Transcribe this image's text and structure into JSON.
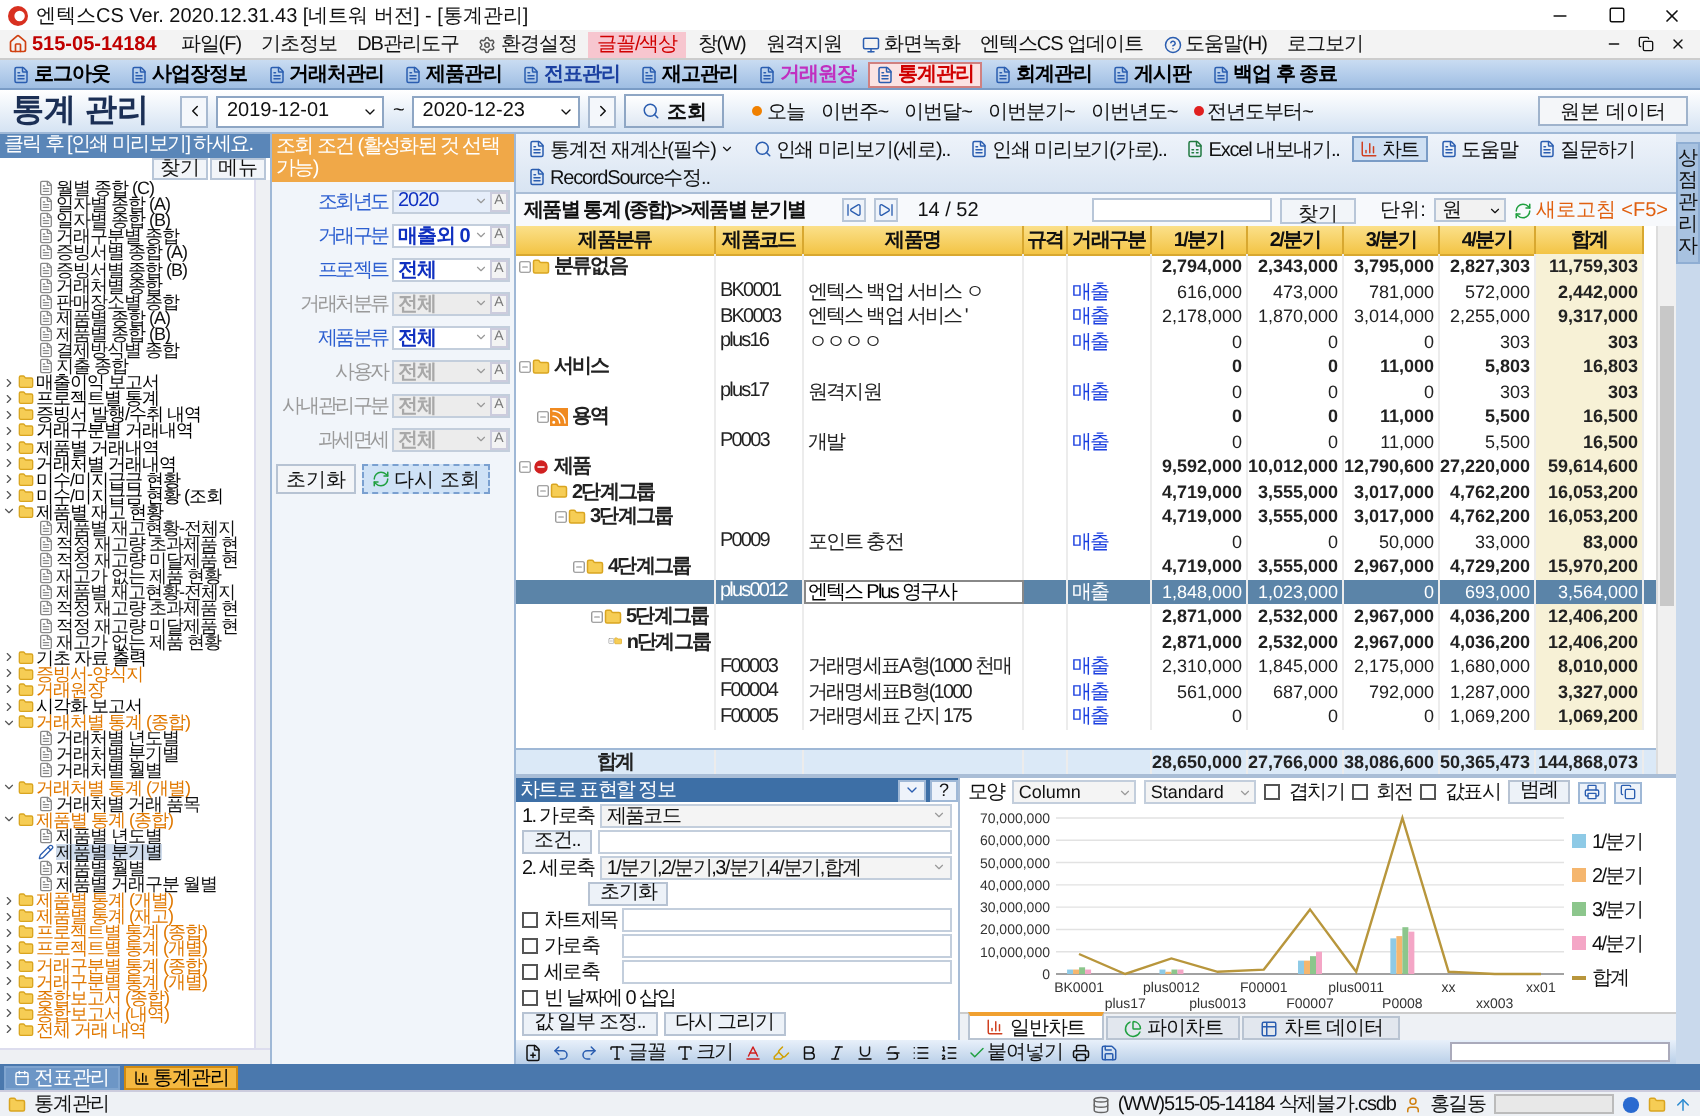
{
  "window": {
    "title": "엔텍스CS Ver. 2020.12.31.43 [네트워 버전] - [통계관리]"
  },
  "menu_bar": {
    "business_number": "515-05-14184",
    "items": [
      {
        "label": "파일(F)",
        "kind": "plain",
        "highlighted": false
      },
      {
        "label": "기초정보",
        "kind": "plain",
        "highlighted": false
      },
      {
        "label": "DB관리도구",
        "kind": "plain",
        "highlighted": false
      },
      {
        "label": "환경설정",
        "kind": "gear",
        "highlighted": false
      },
      {
        "label": "글꼴/색상",
        "kind": "plain",
        "highlighted": true
      },
      {
        "label": "창(W)",
        "kind": "plain",
        "highlighted": false
      },
      {
        "label": "원격지원",
        "kind": "plain",
        "highlighted": false
      },
      {
        "label": "화면녹화",
        "kind": "screen",
        "highlighted": false
      },
      {
        "label": "엔텍스CS 업데이트",
        "kind": "plain",
        "highlighted": false
      },
      {
        "label": "도움말(H)",
        "kind": "help",
        "highlighted": false
      },
      {
        "label": "로그보기",
        "kind": "plain",
        "highlighted": false
      }
    ]
  },
  "toolbar": [
    {
      "label": "로그아웃",
      "color": "#000000",
      "selected": false
    },
    {
      "label": "사업장정보",
      "color": "#000000",
      "selected": false
    },
    {
      "label": "거래처관리",
      "color": "#000000",
      "selected": false
    },
    {
      "label": "제품관리",
      "color": "#000000",
      "selected": false
    },
    {
      "label": "전표관리",
      "color": "#1a3fa0",
      "selected": false
    },
    {
      "label": "재고관리",
      "color": "#000000",
      "selected": false
    },
    {
      "label": "거래원장",
      "color": "#c030c0",
      "selected": false
    },
    {
      "label": "통계관리",
      "color": "#d00000",
      "selected": true
    },
    {
      "label": "회계관리",
      "color": "#000000",
      "selected": false
    },
    {
      "label": "게시판",
      "color": "#000000",
      "selected": false
    },
    {
      "label": "백업 후 종료",
      "color": "#000000",
      "selected": false
    }
  ],
  "header": {
    "title": "통계 관리",
    "date_from": "2019-12-01",
    "range_separator": "~",
    "date_to": "2020-12-23",
    "search_button": "조회",
    "quick_ranges": [
      {
        "label": "오늘",
        "color": "#f08000"
      },
      {
        "label": "이번주~"
      },
      {
        "label": "이번달~"
      },
      {
        "label": "이번분기~"
      },
      {
        "label": "이번년도~"
      },
      {
        "label": "전년도부터~",
        "color": "#e02020"
      }
    ],
    "source_button": "원본 데이터"
  },
  "side_tabs": [
    "상점관리자"
  ],
  "left_panel": {
    "hint": "클릭 후 [인쇄 미리보기] 하세요.",
    "buttons": [
      "찾기",
      "메뉴"
    ],
    "tree": [
      {
        "kind": "group",
        "children": [
          {
            "kind": "report",
            "label": "월별 종합 (C)",
            "selected": false
          },
          {
            "kind": "report",
            "label": "일자별 종합 (A)",
            "selected": false
          },
          {
            "kind": "report",
            "label": "일자별 종합 (B)",
            "selected": false
          },
          {
            "kind": "report",
            "label": "거래구분별 종합",
            "selected": false
          },
          {
            "kind": "report",
            "label": "증빙서별 종합 (A)",
            "selected": false
          },
          {
            "kind": "report",
            "label": "증빙서별 종합 (B)",
            "selected": false
          },
          {
            "kind": "report",
            "label": "거래처별 종합",
            "selected": false
          },
          {
            "kind": "report",
            "label": "판매장소별 종합",
            "selected": false
          },
          {
            "kind": "report",
            "label": "제품별 종합 (A)",
            "selected": false
          },
          {
            "kind": "report",
            "label": "제품별 종합 (B)",
            "selected": false
          },
          {
            "kind": "report",
            "label": "결제방식별 종합",
            "selected": false
          },
          {
            "kind": "report",
            "label": "지출 종합",
            "selected": false
          }
        ]
      },
      {
        "kind": "folder",
        "label": "매출이익 보고서",
        "color": "#000000",
        "expanded": false
      },
      {
        "kind": "folder",
        "label": "프로젝트별 통계",
        "color": "#000000",
        "expanded": false
      },
      {
        "kind": "folder",
        "label": "증빙서 발행/수취 내역",
        "color": "#000000",
        "expanded": false
      },
      {
        "kind": "folder",
        "label": "거래구분별 거래내역",
        "color": "#000000",
        "expanded": false
      },
      {
        "kind": "folder",
        "label": "제품별 거래내역",
        "color": "#000000",
        "expanded": false
      },
      {
        "kind": "folder",
        "label": "거래처별 거래내역",
        "color": "#000000",
        "expanded": false
      },
      {
        "kind": "folder",
        "label": "미수/미지급금 현황",
        "color": "#000000",
        "expanded": false
      },
      {
        "kind": "folder",
        "label": "미수/미지급금 현황 (조회",
        "color": "#000000",
        "expanded": false
      },
      {
        "kind": "folder",
        "label": "제품별 재고 현황",
        "color": "#000000",
        "expanded": true,
        "children": [
          {
            "kind": "report",
            "label": "제품별 재고현황-전체지",
            "selected": false
          },
          {
            "kind": "report",
            "label": "적정 재고량 초과제품 현",
            "selected": false
          },
          {
            "kind": "report",
            "label": "적정 재고량 미달제품 현",
            "selected": false
          },
          {
            "kind": "report",
            "label": "재고가 없는 제품 현황",
            "selected": false
          },
          {
            "kind": "report",
            "label": "제품별 재고현황-전체지",
            "selected": false
          },
          {
            "kind": "report",
            "label": "적정 재고량 초과제품 현",
            "selected": false
          },
          {
            "kind": "report",
            "label": "적정 재고량 미달제품 현",
            "selected": false
          },
          {
            "kind": "report",
            "label": "재고가 없는 제품 현황",
            "selected": false
          }
        ]
      },
      {
        "kind": "folder",
        "label": "기초 자료 출력",
        "color": "#000000",
        "expanded": false
      },
      {
        "kind": "folder",
        "label": "증빙서-양식지",
        "color": "#e07800",
        "expanded": false
      },
      {
        "kind": "folder",
        "label": "거래원장",
        "color": "#e07800",
        "expanded": false
      },
      {
        "kind": "folder",
        "label": "시각화 보고서",
        "color": "#000000",
        "expanded": false
      },
      {
        "kind": "folder",
        "label": "거래처별 통계 (종합)",
        "color": "#e07800",
        "expanded": true,
        "children": [
          {
            "kind": "report",
            "label": "거래처별 년도별",
            "selected": false
          },
          {
            "kind": "report",
            "label": "거래처별 분기별",
            "selected": false
          },
          {
            "kind": "report",
            "label": "거래처별 월별",
            "selected": false
          }
        ]
      },
      {
        "kind": "folder",
        "label": "거래처별 통계 (개별)",
        "color": "#e07800",
        "expanded": true,
        "children": [
          {
            "kind": "report",
            "label": "거래처별 거래 품목",
            "selected": false
          }
        ]
      },
      {
        "kind": "folder",
        "label": "제품별 통계 (종합)",
        "color": "#e07800",
        "expanded": true,
        "children": [
          {
            "kind": "report",
            "label": "제품별 년도별",
            "selected": false
          },
          {
            "kind": "report",
            "label": "제품별 분기별",
            "selected": true
          },
          {
            "kind": "report",
            "label": "제품별 월별",
            "selected": false
          },
          {
            "kind": "report",
            "label": "제품별 거래구분 월별",
            "selected": false
          }
        ]
      },
      {
        "kind": "folder",
        "label": "제품별 통계 (개별)",
        "color": "#e07800",
        "expanded": false
      },
      {
        "kind": "folder",
        "label": "제품별 통계 (재고)",
        "color": "#e07800",
        "expanded": false
      },
      {
        "kind": "folder",
        "label": "프로젝트별 통계 (종합)",
        "color": "#e07800",
        "expanded": false
      },
      {
        "kind": "folder",
        "label": "프로젝트별 통계 (개별)",
        "color": "#e07800",
        "expanded": false
      },
      {
        "kind": "folder",
        "label": "거래구분별 통계 (종합)",
        "color": "#e07800",
        "expanded": false
      },
      {
        "kind": "folder",
        "label": "거래구분별 통계 (개별)",
        "color": "#e07800",
        "expanded": false
      },
      {
        "kind": "folder",
        "label": "종합보고서 (종합)",
        "color": "#e07800",
        "expanded": false
      },
      {
        "kind": "folder",
        "label": "종합보고서 (내역)",
        "color": "#e07800",
        "expanded": false
      },
      {
        "kind": "folder",
        "label": "전체 거래 내역",
        "color": "#e07800",
        "expanded": false
      }
    ]
  },
  "conditions": {
    "title": "조회 조건 (활성화된 것 선택 가능)",
    "fields": [
      {
        "label": "조회년도",
        "value": "2020",
        "kind": "year",
        "enabled": true,
        "button": "A"
      },
      {
        "label": "거래구분",
        "value": "매출외 0",
        "kind": "select",
        "enabled": true,
        "button": "A"
      },
      {
        "label": "프로젝트",
        "value": "전체",
        "kind": "select",
        "enabled": true,
        "button": "A"
      },
      {
        "label": "거래처분류",
        "value": "전체",
        "kind": "select",
        "enabled": false,
        "button": "A"
      },
      {
        "label": "제품분류",
        "value": "전체",
        "kind": "select",
        "enabled": true,
        "button": "A"
      },
      {
        "label": "사용자",
        "value": "전체",
        "kind": "select",
        "enabled": false,
        "button": "A"
      },
      {
        "label": "사내관리구분",
        "value": "전체",
        "kind": "select",
        "enabled": false,
        "button": "A"
      },
      {
        "label": "과세면세",
        "value": "전체",
        "kind": "select",
        "enabled": false,
        "button": "A"
      }
    ],
    "reset_button": "초기화",
    "requery_button": "다시 조회"
  },
  "actions": [
    {
      "label": "통계전 재계산(필수)",
      "kind": "menu",
      "selected": false
    },
    {
      "label": "인쇄 미리보기(세로)..",
      "kind": "preview",
      "selected": false
    },
    {
      "label": "인쇄 미리보기(가로)..",
      "kind": "doc",
      "selected": false
    },
    {
      "label": "Excel 내보내기..",
      "kind": "export",
      "selected": false
    },
    {
      "label": "차트",
      "kind": "chart",
      "selected": true
    },
    {
      "label": "도움말",
      "kind": "doc",
      "selected": false
    },
    {
      "label": "질문하기",
      "kind": "doc",
      "selected": false
    },
    {
      "label": "RecordSource수정..",
      "kind": "doc",
      "selected": false
    }
  ],
  "nav": {
    "breadcrumb": "제품별 통계 (종합)>>제품별 분기별",
    "page": "14 / 52",
    "find_button": "찾기",
    "unit_label": "단위:",
    "unit": "원",
    "refresh": "새로고침 <F5>"
  },
  "table": {
    "columns": [
      "제품분류",
      "제품코드",
      "제품명",
      "규격",
      "거래구분",
      "1/분기",
      "2/분기",
      "3/분기",
      "4/분기",
      "합계"
    ],
    "rows": [
      {
        "kind": "folder",
        "category": "분류없음",
        "values": [
          "2,794,000",
          "2,343,000",
          "3,795,000",
          "2,827,303",
          "11,759,303"
        ],
        "expanded": true,
        "children": [
          {
            "kind": "item",
            "code": "BK0001",
            "name": "엔텍스 백업 서비스  ㅇ",
            "trade": "매출",
            "values": [
              "616,000",
              "473,000",
              "781,000",
              "572,000",
              "2,442,000"
            ],
            "selected": false
          },
          {
            "kind": "item",
            "code": "BK0003",
            "name": "엔텍스 백업 서비스 '",
            "trade": "매출",
            "values": [
              "2,178,000",
              "1,870,000",
              "3,014,000",
              "2,255,000",
              "9,317,000"
            ],
            "selected": false
          },
          {
            "kind": "item",
            "code": "plus16",
            "name": "ㅇㅇㅇㅇ",
            "trade": "매출",
            "values": [
              "0",
              "0",
              "0",
              "303",
              "303"
            ],
            "selected": false
          }
        ]
      },
      {
        "kind": "folder",
        "category": "서비스",
        "values": [
          "0",
          "0",
          "11,000",
          "5,803",
          "16,803"
        ],
        "expanded": true,
        "children": [
          {
            "kind": "item",
            "code": "plus17",
            "name": "원격지원",
            "trade": "매출",
            "values": [
              "0",
              "0",
              "0",
              "303",
              "303"
            ],
            "selected": false
          },
          {
            "kind": "feed",
            "category": "용역",
            "values": [
              "0",
              "0",
              "11,000",
              "5,500",
              "16,500"
            ],
            "expanded": true,
            "children": [
              {
                "kind": "item",
                "code": "P0003",
                "name": "개발",
                "trade": "매출",
                "values": [
                  "0",
                  "0",
                  "11,000",
                  "5,500",
                  "16,500"
                ],
                "selected": false
              }
            ]
          }
        ]
      },
      {
        "kind": "stop",
        "category": "제품",
        "values": [
          "9,592,000",
          "10,012,000",
          "12,790,600",
          "27,220,000",
          "59,614,600"
        ],
        "expanded": true,
        "children": [
          {
            "kind": "folder",
            "category": "2단계그룹",
            "values": [
              "4,719,000",
              "3,555,000",
              "3,017,000",
              "4,762,200",
              "16,053,200"
            ],
            "expanded": true,
            "children": [
              {
                "kind": "folder",
                "category": "3단계그룹",
                "values": [
                  "4,719,000",
                  "3,555,000",
                  "3,017,000",
                  "4,762,200",
                  "16,053,200"
                ],
                "expanded": true,
                "children": [
                  {
                    "kind": "item",
                    "code": "P0009",
                    "name": "포인트 충전",
                    "trade": "매출",
                    "values": [
                      "0",
                      "0",
                      "50,000",
                      "33,000",
                      "83,000"
                    ],
                    "selected": false
                  },
                  {
                    "kind": "folder",
                    "category": "4단계그룹",
                    "values": [
                      "4,719,000",
                      "3,555,000",
                      "2,967,000",
                      "4,729,200",
                      "15,970,200"
                    ],
                    "expanded": true,
                    "children": [
                      {
                        "kind": "item",
                        "code": "plus0012",
                        "name": "엔텍스 Plus 영구사",
                        "trade": "매출",
                        "values": [
                          "1,848,000",
                          "1,023,000",
                          "0",
                          "693,000",
                          "3,564,000"
                        ],
                        "selected": true
                      },
                      {
                        "kind": "folder",
                        "category": "5단계그룹",
                        "values": [
                          "2,871,000",
                          "2,532,000",
                          "2,967,000",
                          "4,036,200",
                          "12,406,200"
                        ],
                        "expanded": true,
                        "children": [
                          {
                            "kind": "folder",
                            "category": "n단계그룹",
                            "values": [
                              "2,871,000",
                              "2,532,000",
                              "2,967,000",
                              "4,036,200",
                              "12,406,200"
                            ],
                            "expanded": true,
                            "children": [
                              {
                                "kind": "item",
                                "code": "F00003",
                                "name": "거래명세표A형(1000 천매",
                                "trade": "매출",
                                "values": [
                                  "2,310,000",
                                  "1,845,000",
                                  "2,175,000",
                                  "1,680,000",
                                  "8,010,000"
                                ],
                                "selected": false
                              },
                              {
                                "kind": "item",
                                "code": "F00004",
                                "name": "거래명세표B형(1000",
                                "trade": "매출",
                                "values": [
                                  "561,000",
                                  "687,000",
                                  "792,000",
                                  "1,287,000",
                                  "3,327,000"
                                ],
                                "selected": false
                              },
                              {
                                "kind": "item",
                                "code": "F00005",
                                "name": "거래명세표 간지 175",
                                "trade": "매출",
                                "values": [
                                  "0",
                                  "0",
                                  "0",
                                  "1,069,200",
                                  "1,069,200"
                                ],
                                "selected": false
                              }
                            ]
                          }
                        ]
                      }
                    ]
                  }
                ]
              }
            ]
          }
        ]
      }
    ],
    "total": {
      "label": "합계",
      "values": [
        "28,650,000",
        "27,766,000",
        "38,086,600",
        "50,365,473",
        "144,868,073"
      ]
    }
  },
  "chart_panel": {
    "title": "차트로 표현할 정보",
    "help": "?",
    "x_axis": {
      "label": "1. 가로축",
      "value": "제품코드"
    },
    "condition_button": "조건..",
    "y_axis": {
      "label": "2. 세로축",
      "value": "1/분기,2/분기,3/분기,4/분기,합계"
    },
    "reset_button": "초기화",
    "options": [
      {
        "label": "차트제목",
        "kind": "input",
        "checked": false
      },
      {
        "label": "가로축",
        "kind": "input",
        "checked": false
      },
      {
        "label": "세로축",
        "kind": "input",
        "checked": false
      },
      {
        "label": "빈 날짜에 0 삽입",
        "kind": "plain",
        "checked": false
      }
    ],
    "buttons": [
      "값 일부 조정..",
      "다시 그리기"
    ]
  },
  "chart": {
    "shape_label": "모양",
    "shape": "Column",
    "style": "Standard",
    "toggles": [
      {
        "label": "겹치기",
        "checked": false
      },
      {
        "label": "회전",
        "checked": false
      },
      {
        "label": "값표시",
        "checked": false
      }
    ],
    "legend_button": "범례",
    "chart_data": {
      "type": "bar",
      "categories": [
        "BK0001",
        "plus17",
        "plus0012",
        "plus0013",
        "F00001",
        "F00007",
        "plus0011",
        "P0008",
        "xx",
        "xx003",
        "xx01"
      ],
      "series": [
        {
          "name": "1/분기",
          "color": "#8ecae6",
          "values": [
            2000000,
            0,
            2000000,
            0,
            0,
            6000000,
            0,
            16000000,
            0,
            0,
            0
          ]
        },
        {
          "name": "2/분기",
          "color": "#f5b66e",
          "values": [
            2000000,
            0,
            1000000,
            0,
            0,
            6000000,
            0,
            17000000,
            0,
            0,
            0
          ]
        },
        {
          "name": "3/분기",
          "color": "#8cc68c",
          "values": [
            3000000,
            0,
            2000000,
            0,
            0,
            8000000,
            0,
            21000000,
            0,
            0,
            0
          ]
        },
        {
          "name": "4/분기",
          "color": "#f4a6c6",
          "values": [
            2000000,
            0,
            2000000,
            0,
            null,
            10000000,
            0,
            19000000,
            0,
            0,
            0
          ]
        },
        {
          "name": "합계",
          "color": "#b8963c",
          "type": "line",
          "values": [
            9000000,
            0,
            7000000,
            1000000,
            2000000,
            29000000,
            1000000,
            70000000,
            1000000,
            0,
            0
          ]
        }
      ],
      "ylim": [
        0,
        70000000
      ],
      "grid": true,
      "legend": "right",
      "yticks": [
        {
          "value": 0,
          "label": "0"
        },
        {
          "value": 10000000,
          "label": "10,000,000"
        },
        {
          "value": 20000000,
          "label": "20,000,000"
        },
        {
          "value": 30000000,
          "label": "30,000,000"
        },
        {
          "value": 40000000,
          "label": "40,000,000"
        },
        {
          "value": 50000000,
          "label": "50,000,000"
        },
        {
          "value": 60000000,
          "label": "60,000,000"
        },
        {
          "value": 70000000,
          "label": "70,000,000"
        }
      ]
    },
    "tabs": [
      {
        "label": "일반차트",
        "kind": "bar",
        "selected": true
      },
      {
        "label": "파이차트",
        "kind": "pie",
        "selected": false
      },
      {
        "label": "차트 데이터",
        "kind": "table",
        "selected": false
      }
    ]
  },
  "editor": {
    "font": "글꼴",
    "size": "크기",
    "paste": "붙여넣기"
  },
  "taskbar": [
    {
      "label": "전표관리",
      "selected": false
    },
    {
      "label": "통계관리",
      "selected": true
    }
  ],
  "status_bar": {
    "screen": "통계관리",
    "database": "(WW)515-05-14184 삭제불가.csdb",
    "user": "홍길동"
  }
}
